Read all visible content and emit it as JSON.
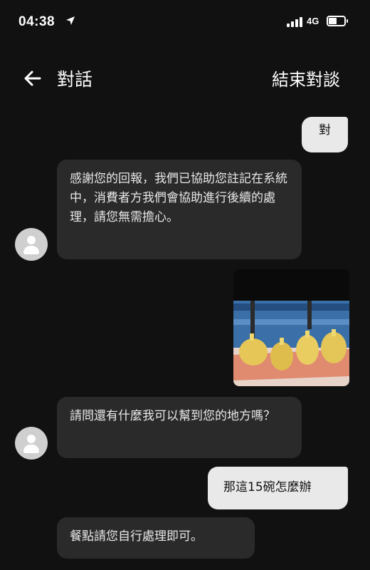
{
  "status_bar": {
    "time": "04:38",
    "network": "4G"
  },
  "header": {
    "title": "對話",
    "end_label": "結束對談"
  },
  "messages": {
    "user_1": "對",
    "bot_1": "感謝您的回報，我們已協助您註記在系統中，消費者方我們會協助進行後續的處理，請您無需擔心。",
    "bot_2": "請問還有什麼我可以幫到您的地方嗎？",
    "user_2": "那這15碗怎麼辦",
    "bot_3": "餐點請您自行處理即可。"
  },
  "colors": {
    "background": "#111111",
    "bot_bubble": "#2a2a2a",
    "user_bubble": "#e9e9e9"
  }
}
